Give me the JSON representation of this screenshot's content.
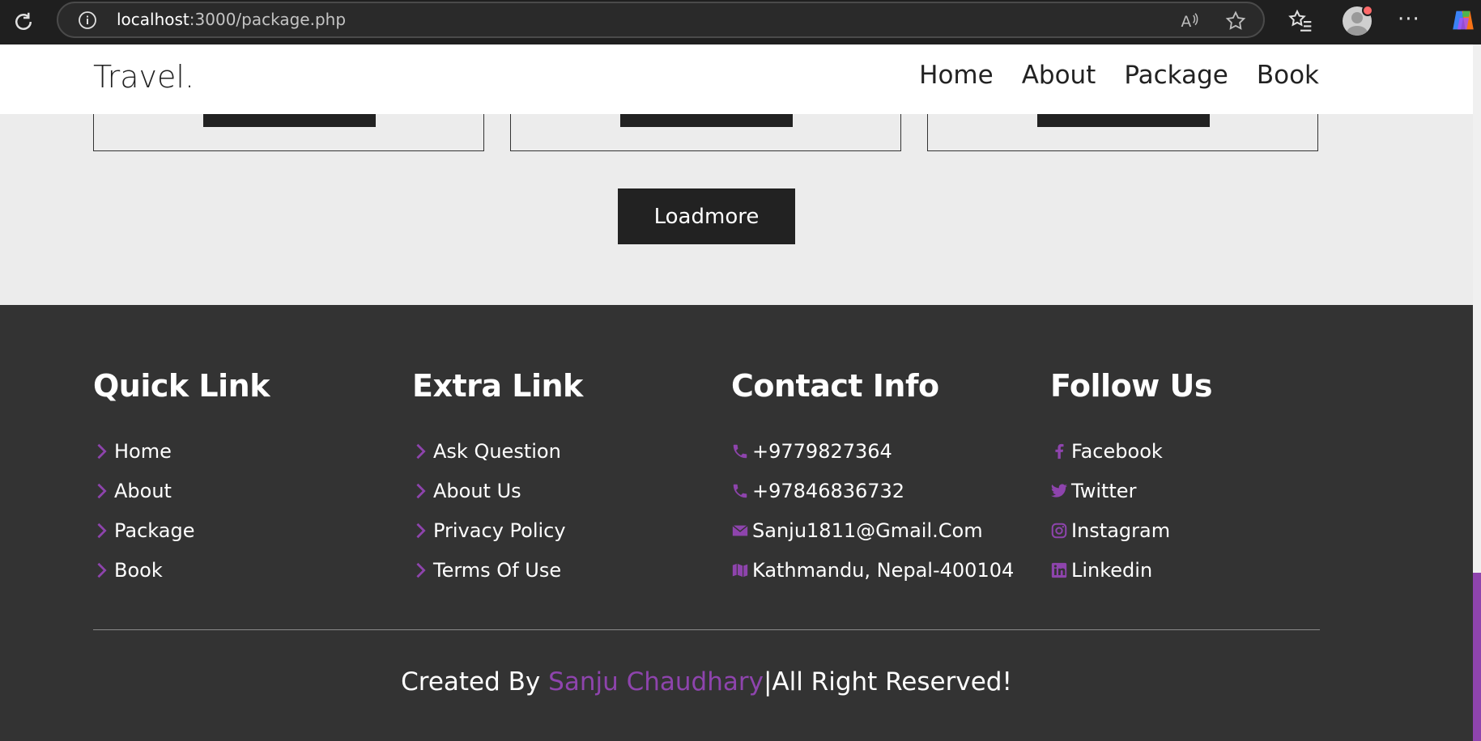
{
  "browser": {
    "url_host": "localhost",
    "url_path": ":3000/package.php"
  },
  "header": {
    "logo": "Travel.",
    "nav": [
      "Home",
      "About",
      "Package",
      "Book"
    ]
  },
  "main": {
    "loadmore_label": "Loadmore"
  },
  "footer": {
    "quick_link": {
      "title": "Quick Link",
      "items": [
        "Home",
        "About",
        "Package",
        "Book"
      ]
    },
    "extra_link": {
      "title": "Extra Link",
      "items": [
        "Ask Question",
        "About Us",
        "Privacy Policy",
        "Terms Of Use"
      ]
    },
    "contact_info": {
      "title": "Contact Info",
      "items": [
        "+9779827364",
        "+97846836732",
        "Sanju1811@Gmail.Com",
        "Kathmandu, Nepal-400104"
      ]
    },
    "follow_us": {
      "title": "Follow Us",
      "items": [
        "Facebook",
        "Twitter",
        "Instagram",
        "Linkedin"
      ]
    },
    "credit_prefix": "Created By ",
    "credit_name": "Sanju Chaudhary",
    "credit_suffix": "|All Right Reserved!"
  },
  "colors": {
    "accent": "#8e44ad",
    "footer_bg": "#333333",
    "page_bg": "#ececec",
    "button_bg": "#222222"
  },
  "icons": {
    "chevron": "chevron-right-icon",
    "phone": "phone-icon",
    "email": "envelope-icon",
    "map": "map-icon",
    "facebook": "facebook-icon",
    "twitter": "twitter-icon",
    "instagram": "instagram-icon",
    "linkedin": "linkedin-icon"
  }
}
